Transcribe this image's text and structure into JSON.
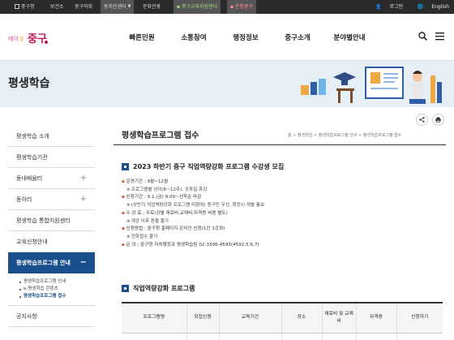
{
  "topbar": {
    "items": [
      "중구청",
      "보건소",
      "중구의회",
      "동주민센터",
      "문화관광",
      "중구교육지원센터",
      "온통중구"
    ],
    "login": "로그인",
    "english": "English"
  },
  "gnb": [
    "빠른민원",
    "소통참여",
    "행정정보",
    "중구소개",
    "분야별안내"
  ],
  "banner": {
    "title": "평생학습"
  },
  "sidebar": {
    "items": [
      "평생학습 소개",
      "평생학습기관",
      "동네배움터",
      "동아리",
      "평생학습 통합지원센터",
      "교육신청안내",
      "평생학습프로그램 안내",
      "공지사항"
    ],
    "subitems": [
      "평생학습프로그램 안내",
      "e-평생학습 콘텐츠",
      "평생학습프로그램 접수"
    ]
  },
  "page": {
    "title": "평생학습프로그램 접수",
    "breadcrumb": "홈 > 평생학습 > 평생학습프로그램 안내 > 평생학습프로그램 접수"
  },
  "notice": {
    "heading": "2023 하반기 중구 직업역량강화 프로그램 수강생 모집",
    "lines": [
      "운영기간 : 9월~12월",
      "프로그램별 상이(8~12주), 공휴일 휴강",
      "신청기간 : 9.1.(금) 9:00~선착순 마감",
      "(상반기 직업역량강화 프로그램 미참여) 중구민 우선, 확정시 개별 통보",
      "수 강 료 : 무료(강별 재료비,교재비,자격증 비용 별도)",
      "개강 이후 환불 불가",
      "신청방법 : 중구청 홈페이지 온라인 신청(1인 1강좌)",
      "전화접수 불가",
      "문 의 : 중구청 자치행정과 평생학습팀 02-3396-4593(4592,5,6,7)"
    ]
  },
  "program": {
    "heading": "직업역량강화 프로그램",
    "columns": [
      "프로그램명",
      "모집인원",
      "교육기간",
      "장소",
      "재료비 및 교재비",
      "자격증",
      "신청하기"
    ]
  }
}
